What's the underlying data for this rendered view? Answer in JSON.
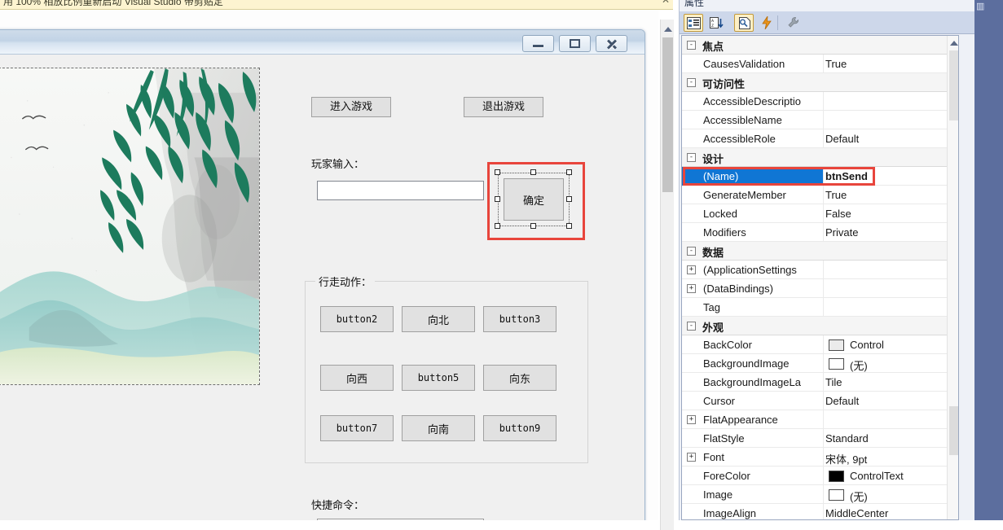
{
  "notification_bar": {
    "text": "用 100% 相放比例重新启动 Visual Studio  带剪贴定",
    "close_label": "✕",
    "background": "#fdf4d0"
  },
  "design_form": {
    "caption": "",
    "window_buttons": [
      {
        "name": "minimize",
        "icon": "minimize-icon"
      },
      {
        "name": "maximize",
        "icon": "maximize-icon"
      },
      {
        "name": "close",
        "icon": "close-icon"
      }
    ],
    "picture_box": {
      "name": "pictureBox1",
      "description": "Chinese ink-wash landscape: willow branches, misty mountains, two birds"
    },
    "top_buttons": [
      {
        "label": "进入游戏"
      },
      {
        "label": "退出游戏"
      }
    ],
    "player_input": {
      "label": "玩家输入：",
      "textbox_value": "",
      "textbox_placeholder": ""
    },
    "selected_control": {
      "text": "确定",
      "selected": true,
      "selection_color": "#e8453c",
      "handle_count": 8
    },
    "walk_group": {
      "title": "行走动作：",
      "buttons": [
        {
          "label": "button2"
        },
        {
          "label": "向北"
        },
        {
          "label": "button3"
        },
        {
          "label": "向西"
        },
        {
          "label": "button5"
        },
        {
          "label": "向东"
        },
        {
          "label": "button7"
        },
        {
          "label": "向南"
        },
        {
          "label": "button9"
        }
      ]
    },
    "quick_command": {
      "label": "快捷命令：",
      "combo_value": "",
      "arrow_icon": "chevron-down-icon"
    }
  },
  "properties_window": {
    "title": "属性",
    "toolbar": [
      {
        "name": "categorized",
        "icon": "categorized-icon",
        "active": true
      },
      {
        "name": "alphabetical",
        "icon": "sort-az-icon",
        "active": false
      },
      {
        "name": "property-pages",
        "icon": "property-pages-icon",
        "active": true
      },
      {
        "name": "events",
        "icon": "lightning-icon",
        "active": false
      },
      {
        "name": "settings",
        "icon": "wrench-icon",
        "active": false
      }
    ],
    "selected_row_highlight": "#1076d4",
    "annotation_color": "#e8453c",
    "rows": [
      {
        "type": "category",
        "expander": "-",
        "label": "焦点"
      },
      {
        "type": "prop",
        "name": "CausesValidation",
        "value": "True"
      },
      {
        "type": "category",
        "expander": "-",
        "label": "可访问性"
      },
      {
        "type": "prop",
        "name": "AccessibleDescriptio",
        "value": ""
      },
      {
        "type": "prop",
        "name": "AccessibleName",
        "value": ""
      },
      {
        "type": "prop",
        "name": "AccessibleRole",
        "value": "Default"
      },
      {
        "type": "category",
        "expander": "-",
        "label": "设计"
      },
      {
        "type": "prop",
        "name": "(Name)",
        "value": "btnSend",
        "selected": true,
        "annotated": true
      },
      {
        "type": "prop",
        "name": "GenerateMember",
        "value": "True"
      },
      {
        "type": "prop",
        "name": "Locked",
        "value": "False"
      },
      {
        "type": "prop",
        "name": "Modifiers",
        "value": "Private"
      },
      {
        "type": "category",
        "expander": "-",
        "label": "数据"
      },
      {
        "type": "prop",
        "name": "(ApplicationSettings",
        "value": "",
        "expander": "+"
      },
      {
        "type": "prop",
        "name": "(DataBindings)",
        "value": "",
        "expander": "+"
      },
      {
        "type": "prop",
        "name": "Tag",
        "value": ""
      },
      {
        "type": "category",
        "expander": "-",
        "label": "外观"
      },
      {
        "type": "prop",
        "name": "BackColor",
        "value": "Control",
        "swatch": "#ebebeb"
      },
      {
        "type": "prop",
        "name": "BackgroundImage",
        "value": "(无)",
        "swatch": "#ffffff"
      },
      {
        "type": "prop",
        "name": "BackgroundImageLa",
        "value": "Tile"
      },
      {
        "type": "prop",
        "name": "Cursor",
        "value": "Default"
      },
      {
        "type": "prop",
        "name": "FlatAppearance",
        "value": "",
        "expander": "+"
      },
      {
        "type": "prop",
        "name": "FlatStyle",
        "value": "Standard"
      },
      {
        "type": "prop",
        "name": "Font",
        "value": "宋体, 9pt",
        "expander": "+"
      },
      {
        "type": "prop",
        "name": "ForeColor",
        "value": "ControlText",
        "swatch": "#000000"
      },
      {
        "type": "prop",
        "name": "Image",
        "value": "(无)",
        "swatch": "#ffffff"
      },
      {
        "type": "prop",
        "name": "ImageAlign",
        "value": "MiddleCenter"
      }
    ]
  },
  "dock_strip": {
    "icon": "panel-icon",
    "color": "#5c6e9e"
  }
}
